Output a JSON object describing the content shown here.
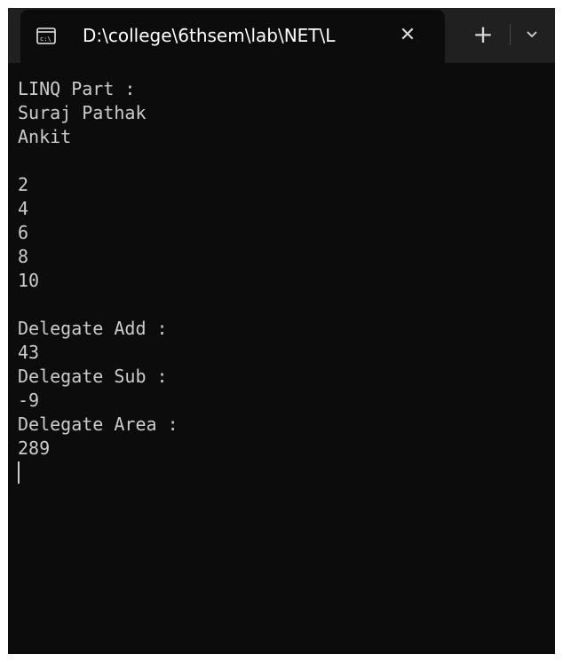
{
  "window": {
    "tab_title": "D:\\college\\6thsem\\lab\\NET\\L",
    "tab_icon": "cmd-icon",
    "close_label": "✕",
    "new_tab_label": "+",
    "dropdown_icon": "chevron-down-icon"
  },
  "terminal": {
    "lines": [
      "LINQ Part :",
      "Suraj Pathak",
      "Ankit",
      "",
      "2",
      "4",
      "6",
      "8",
      "10",
      "",
      "Delegate Add :",
      "43",
      "Delegate Sub :",
      "-9",
      "Delegate Area :",
      "289"
    ]
  },
  "colors": {
    "background": "#0c0c0c",
    "titlebar": "#202020",
    "text": "#cccccc"
  }
}
